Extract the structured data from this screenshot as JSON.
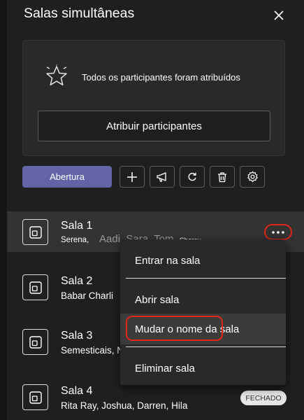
{
  "panel": {
    "title": "Salas simultâneas",
    "close_icon": "close-icon"
  },
  "assign_card": {
    "icon": "star-icon",
    "message": "Todos os participantes foram atribuídos",
    "button_label": "Atribuir participantes"
  },
  "toolbar": {
    "open_label": "Abertura",
    "tools": [
      "add-icon",
      "announcement-icon",
      "refresh-icon",
      "delete-icon",
      "settings-icon"
    ]
  },
  "rooms": [
    {
      "name": "Sala 1",
      "participants": "Serena,",
      "overflow_names": "Aadi, Sara, Tom,",
      "overflow_extra": "Chorou"
    },
    {
      "name": "Sala 2",
      "participants": "Babar Charli"
    },
    {
      "name": "Sala 3",
      "participants": "Semesticais, Nat"
    },
    {
      "name": "Sala 4",
      "participants": "Rita Ray, Joshua, Darren, Hila",
      "status": "FECHADO"
    }
  ],
  "context_menu": {
    "items": [
      "Entrar na sala",
      "Abrir sala",
      "Mudar o nome da sala",
      "Eliminar sala"
    ]
  },
  "colors": {
    "background": "#1f1f1f",
    "accent": "#6264a7",
    "highlight_ring": "#e0251b"
  }
}
